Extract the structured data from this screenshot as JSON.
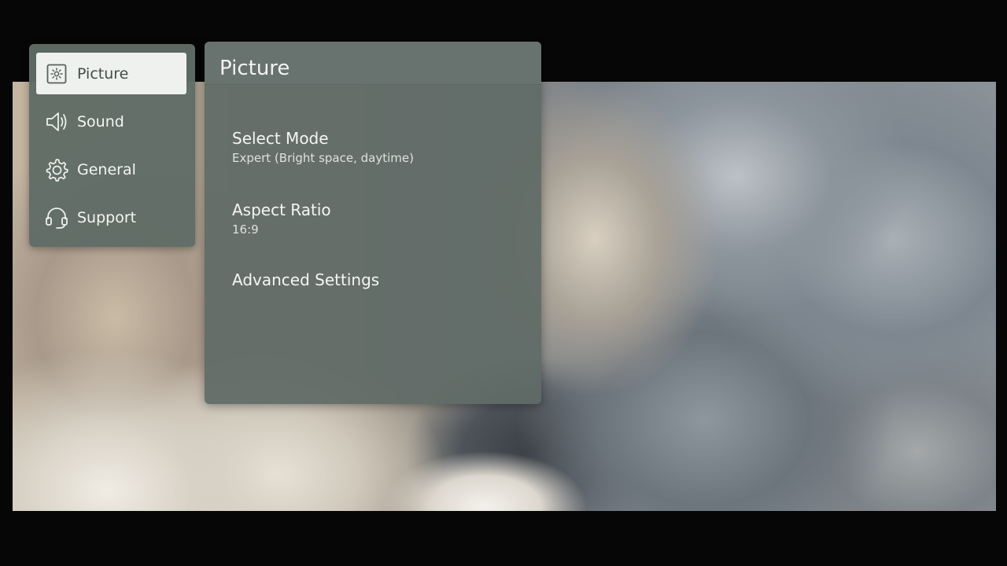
{
  "side_menu": {
    "items": [
      {
        "label": "Picture",
        "icon": "picture-icon",
        "selected": true
      },
      {
        "label": "Sound",
        "icon": "speaker-icon",
        "selected": false
      },
      {
        "label": "General",
        "icon": "gear-icon",
        "selected": false
      },
      {
        "label": "Support",
        "icon": "headset-icon",
        "selected": false
      }
    ]
  },
  "panel": {
    "title": "Picture",
    "options": [
      {
        "label": "Select Mode",
        "value": "Expert (Bright space, daytime)"
      },
      {
        "label": "Aspect Ratio",
        "value": "16:9"
      },
      {
        "label": "Advanced Settings",
        "value": ""
      }
    ]
  },
  "colors": {
    "menu_background": "#606c66",
    "selected_item_background": "#eef1ee",
    "text_primary": "#f4f6f4"
  }
}
